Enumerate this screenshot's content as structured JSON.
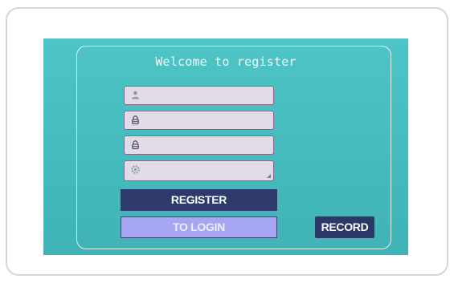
{
  "register_screen": {
    "title": "Welcome to register",
    "fields": [
      {
        "icon": "user-icon",
        "value": ""
      },
      {
        "icon": "lock-icon",
        "value": ""
      },
      {
        "icon": "lock-icon",
        "value": ""
      },
      {
        "icon": "gear-icon",
        "value": ""
      }
    ],
    "buttons": {
      "register": "REGISTER",
      "to_login": "TO LOGIN",
      "record": "RECORD"
    }
  },
  "colors": {
    "screen_background": "#46bcbe",
    "field_background": "#e2dbe7",
    "register_button": "#2e3a6c",
    "to_login_button": "#a7a6f2",
    "record_button": "#2b3868"
  }
}
